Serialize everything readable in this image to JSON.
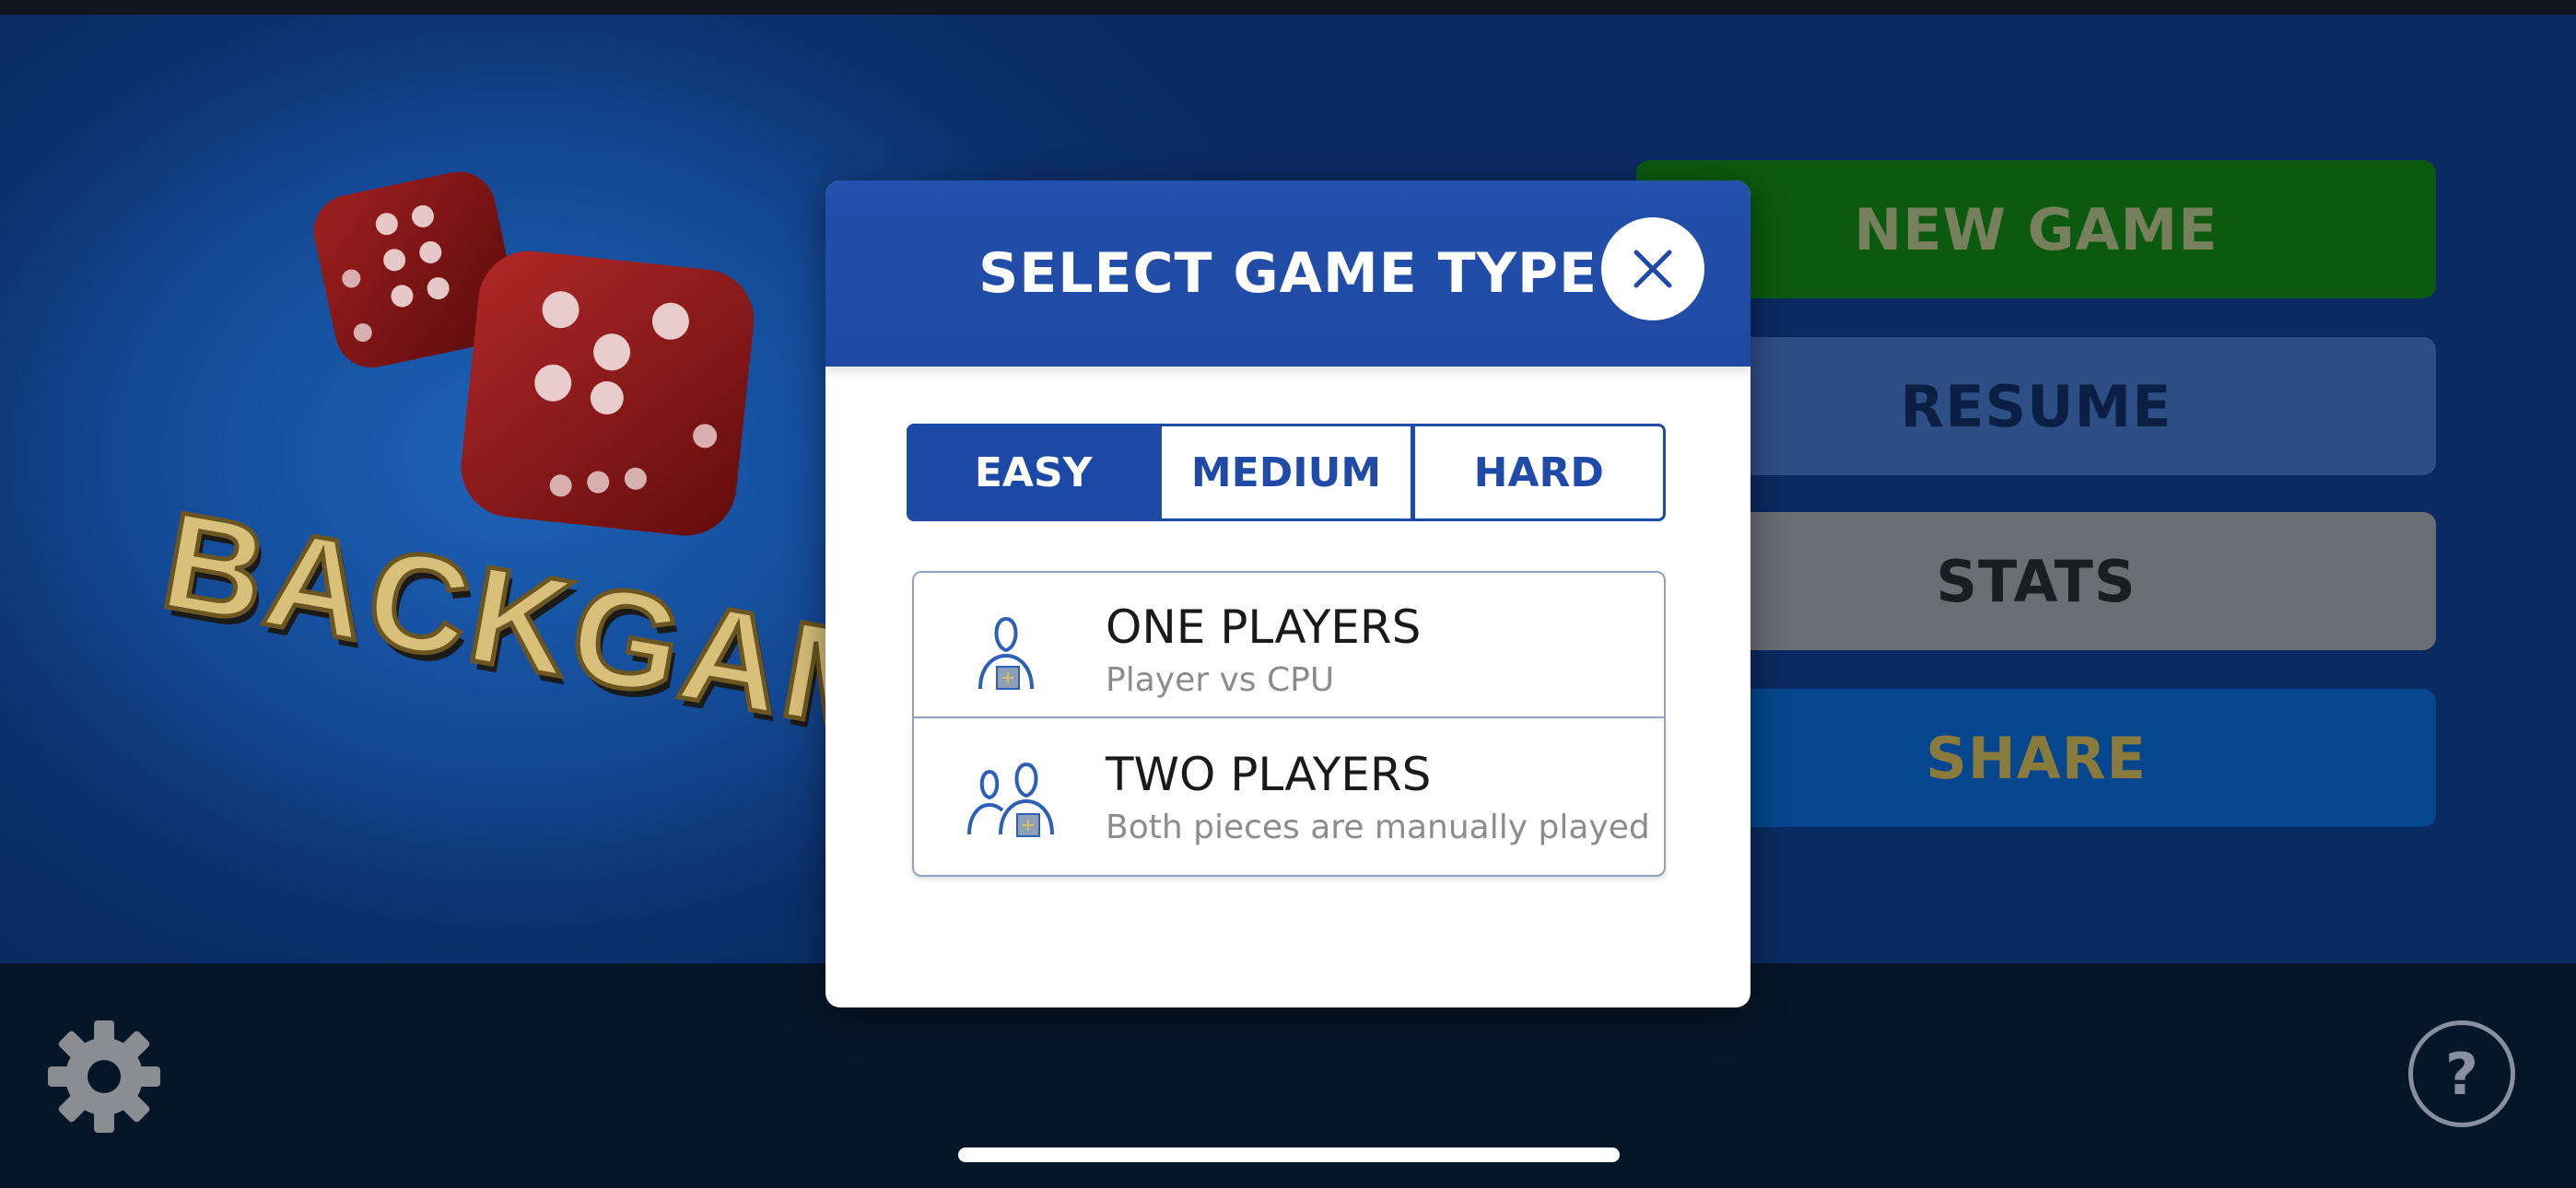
{
  "background": {
    "logo_text": "BACKGAMM",
    "menu": {
      "new_game": "NEW GAME",
      "resume": "RESUME",
      "stats": "STATS",
      "share": "SHARE"
    },
    "help_glyph": "?",
    "icons": [
      "gear-icon",
      "help-icon",
      "dice-icon"
    ]
  },
  "modal": {
    "title": "SELECT GAME TYPE",
    "close_icon": "close-icon",
    "difficulty_tabs": [
      {
        "label": "EASY",
        "selected": true
      },
      {
        "label": "MEDIUM",
        "selected": false
      },
      {
        "label": "HARD",
        "selected": false
      }
    ],
    "options": [
      {
        "title": "ONE PLAYERS",
        "subtitle": "Player vs CPU",
        "icon": "single-player-icon"
      },
      {
        "title": "TWO PLAYERS",
        "subtitle": "Both pieces are manually played",
        "icon": "two-players-icon"
      }
    ]
  },
  "colors": {
    "header_blue": "#2350ad",
    "accent_blue": "#1f4aa8",
    "overlay_dark": "#061629"
  }
}
